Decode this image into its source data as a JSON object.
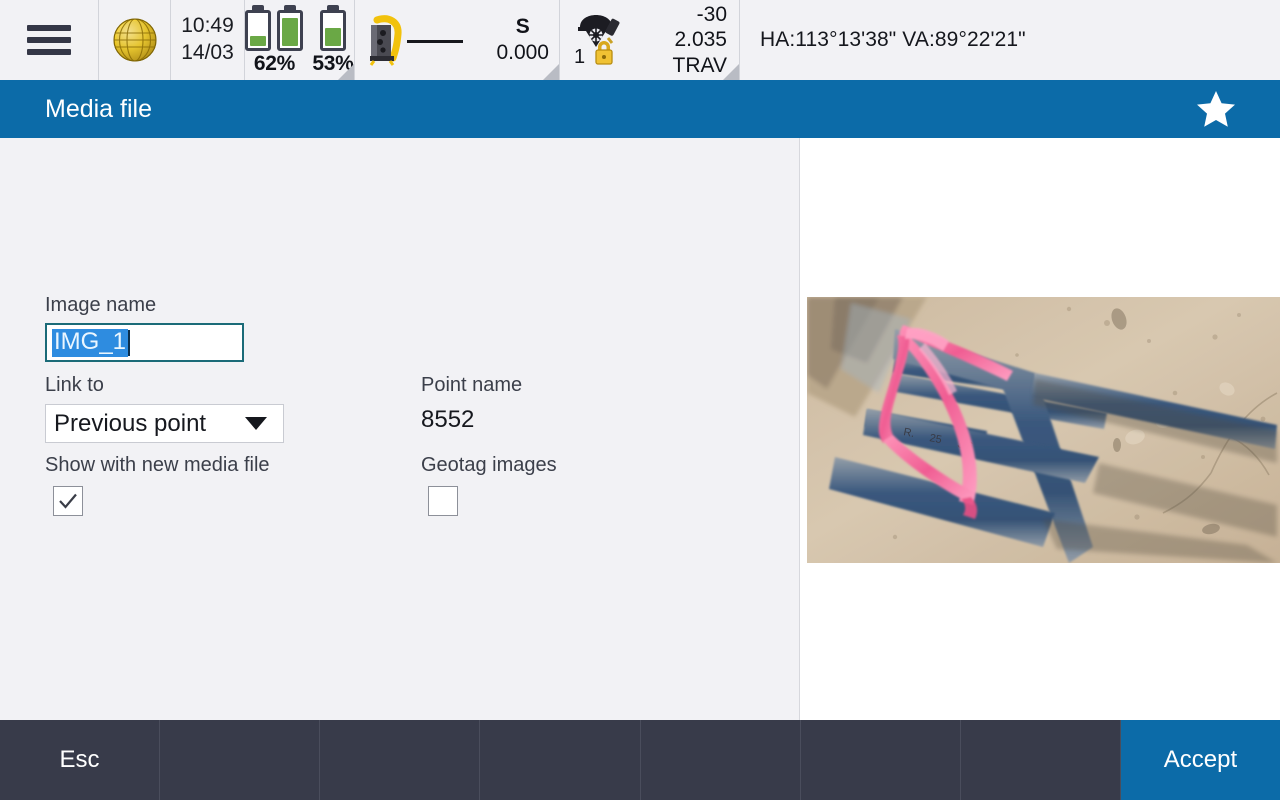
{
  "statusbar": {
    "menu_icon": "hamburger-menu-icon",
    "globe_icon": "globe-icon",
    "time": "10:49",
    "date": "14/03",
    "battery_primary_pct": "62%",
    "battery_secondary_pct": "53%",
    "instrument_icon": "total-station-icon",
    "instrument_mode": "S",
    "instrument_distance": "0.000",
    "target_icon": "prism-target-icon",
    "target_lock_icon": "lock-icon",
    "target_number": "1",
    "target_height": "-30",
    "target_value": "2.035",
    "target_mode": "TRAV",
    "angles": "HA:113°13'38\"  VA:89°22'21\""
  },
  "titlebar": {
    "title": "Media file",
    "favorite_icon": "star-icon"
  },
  "form": {
    "image_name_label": "Image name",
    "image_name_value": "IMG_1",
    "link_to_label": "Link to",
    "link_to_value": "Previous point",
    "link_to_options": [
      "Previous point"
    ],
    "point_name_label": "Point name",
    "point_name_value": "8552",
    "show_with_new_media_label": "Show with new media file",
    "show_with_new_media_checked": "✓",
    "geotag_images_label": "Geotag images",
    "geotag_images_checked": ""
  },
  "preview": {
    "photo_alt": "survey-site-photo"
  },
  "bottombar": {
    "esc_label": "Esc",
    "empty_1": "",
    "empty_2": "",
    "empty_3": "",
    "empty_4": "",
    "empty_5": "",
    "empty_6": "",
    "accept_label": "Accept"
  },
  "colors": {
    "accent_blue": "#0c6ba8",
    "bottom_bar": "#383b4a",
    "status_bg": "#f2f2f5",
    "battery_green": "#6aa845",
    "selection_blue": "#2e8ce0",
    "input_border": "#1b6b78"
  }
}
